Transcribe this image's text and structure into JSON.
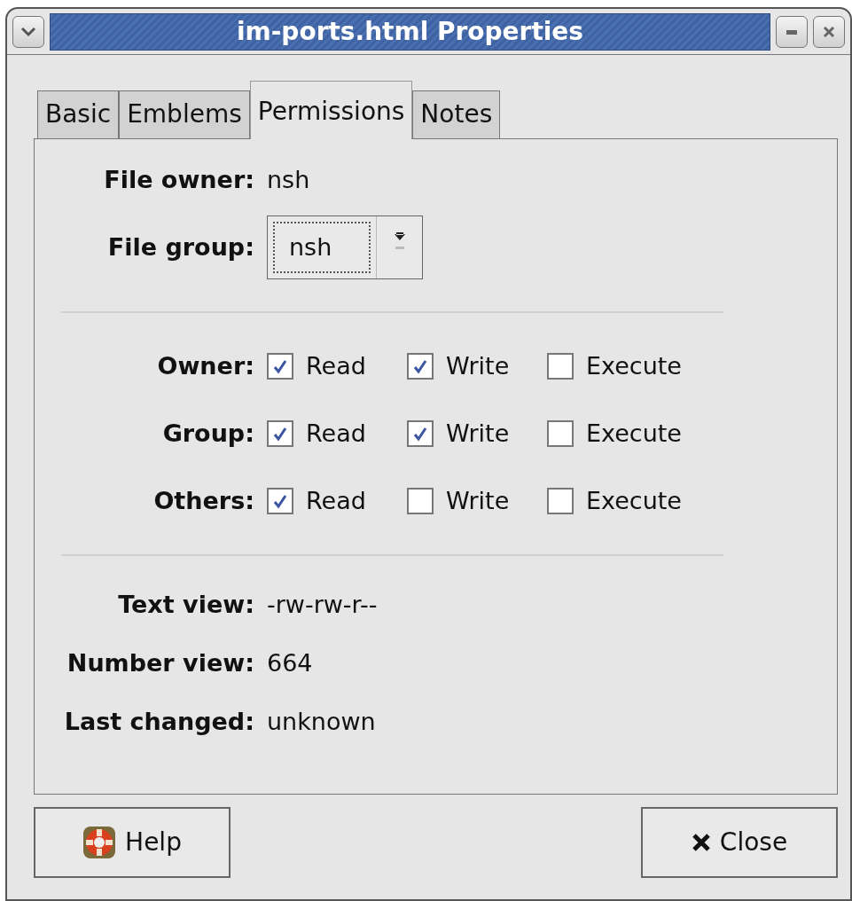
{
  "window": {
    "title": "im-ports.html Properties"
  },
  "tabs": [
    {
      "label": "Basic",
      "selected": false
    },
    {
      "label": "Emblems",
      "selected": false
    },
    {
      "label": "Permissions",
      "selected": true
    },
    {
      "label": "Notes",
      "selected": false
    }
  ],
  "file_owner": {
    "label": "File owner:",
    "value": "nsh"
  },
  "file_group": {
    "label": "File group:",
    "value": "nsh"
  },
  "permissions": [
    {
      "label": "Owner:",
      "options": [
        {
          "label": "Read",
          "checked": true
        },
        {
          "label": "Write",
          "checked": true
        },
        {
          "label": "Execute",
          "checked": false
        }
      ]
    },
    {
      "label": "Group:",
      "options": [
        {
          "label": "Read",
          "checked": true
        },
        {
          "label": "Write",
          "checked": true
        },
        {
          "label": "Execute",
          "checked": false
        }
      ]
    },
    {
      "label": "Others:",
      "options": [
        {
          "label": "Read",
          "checked": true
        },
        {
          "label": "Write",
          "checked": false
        },
        {
          "label": "Execute",
          "checked": false
        }
      ]
    }
  ],
  "info": [
    {
      "label": "Text view:",
      "value": "-rw-rw-r--"
    },
    {
      "label": "Number view:",
      "value": "664"
    },
    {
      "label": "Last changed:",
      "value": "unknown"
    }
  ],
  "buttons": [
    {
      "kind": "help",
      "label": "Help"
    },
    {
      "kind": "close",
      "label": "Close"
    }
  ]
}
